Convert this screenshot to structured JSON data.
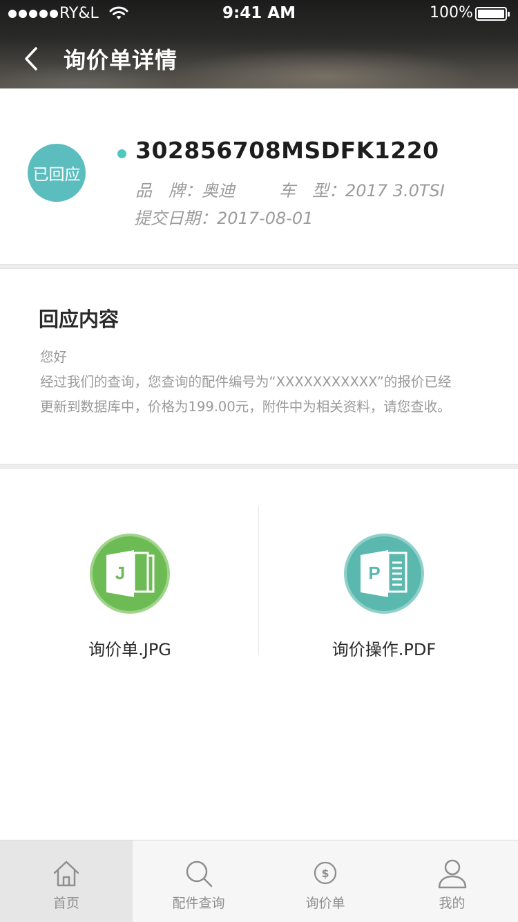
{
  "status_bar": {
    "carrier": "RY&L",
    "time": "9:41 AM",
    "battery": "100%",
    "battery_level": 1.0
  },
  "nav": {
    "back_icon": "chevron-left-icon",
    "title": "询价单详情"
  },
  "inquiry": {
    "status": "已回应",
    "status_color": "#5cbdbf",
    "number": "302856708MSDFK1220",
    "brand": "品　牌：奥迪",
    "model": "车　型：2017 3.0TSI",
    "submit_date": "提交日期：2017-08-01"
  },
  "reply": {
    "title": "回应内容",
    "lines": [
      "您好",
      "经过我们的查询，您查询的配件编号为“XXXXXXXXXXX”的报价已经",
      "更新到数据库中，价格为199.00元，附件中为相关资料，请您查收。"
    ]
  },
  "attachments": [
    {
      "label": "询价单.JPG",
      "icon": "jpg-file-icon",
      "color": "#6dbb55",
      "letter": "J"
    },
    {
      "label": "询价操作.PDF",
      "icon": "pdf-file-icon",
      "color": "#5ab8af",
      "letter": "P"
    }
  ],
  "tabbar": {
    "items": [
      {
        "label": "首页",
        "icon": "home-icon",
        "active": true
      },
      {
        "label": "配件查询",
        "icon": "search-icon",
        "active": false
      },
      {
        "label": "询价单",
        "icon": "dollar-circle-icon",
        "active": false
      },
      {
        "label": "我的",
        "icon": "user-icon",
        "active": false
      }
    ]
  }
}
